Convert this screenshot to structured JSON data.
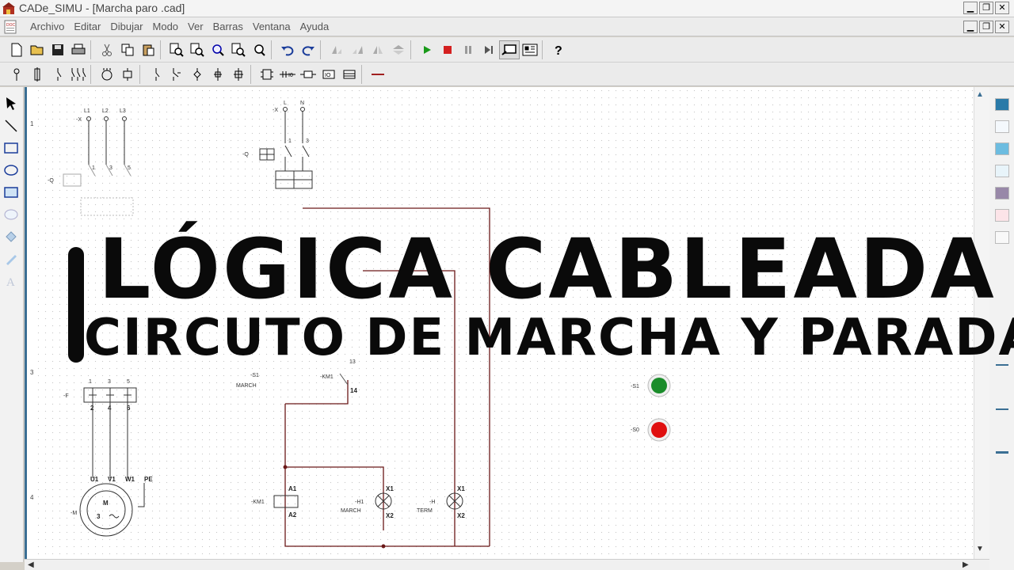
{
  "window": {
    "title": "CADe_SIMU - [Marcha paro .cad]"
  },
  "menu": {
    "items": [
      "Archivo",
      "Editar",
      "Dibujar",
      "Modo",
      "Ver",
      "Barras",
      "Ventana",
      "Ayuda"
    ]
  },
  "overlay": {
    "title": "LÓGICA CABLEADA",
    "subtitle": "CIRCUTO DE MARCHA Y PARADA"
  },
  "schematic": {
    "supply_left": [
      "L1",
      "L2",
      "L3"
    ],
    "supply_left_pins": [
      "1",
      "3",
      "5"
    ],
    "supply_right": [
      "L",
      "N"
    ],
    "supply_right_pins": [
      "1",
      "3"
    ],
    "terminal_x": "-X",
    "breaker_q": "-Q",
    "relay_f": "-F",
    "relay_f_top": [
      "1",
      "3",
      "5"
    ],
    "relay_f_bottom": [
      "2",
      "4",
      "6"
    ],
    "motor": {
      "id": "-M",
      "letter": "M",
      "phases": "3",
      "terms": [
        "U1",
        "V1",
        "W1",
        "PE"
      ]
    },
    "coil": {
      "id": "-KM1",
      "a1": "A1",
      "a2": "A2"
    },
    "lamp_march": {
      "id": "-H1",
      "label": "MARCH",
      "x1": "X1",
      "x2": "X2"
    },
    "lamp_term": {
      "id": "-H",
      "label": "TERM",
      "x1": "X1",
      "x2": "X2"
    },
    "button_s1": {
      "id": "-S1",
      "label": "MARCH",
      "contact": "13",
      "contact2": "14",
      "km": "-KM1"
    },
    "pilot_s1": "-S1",
    "pilot_s0": "-S0",
    "ruler": [
      "1",
      "3",
      "4"
    ]
  }
}
